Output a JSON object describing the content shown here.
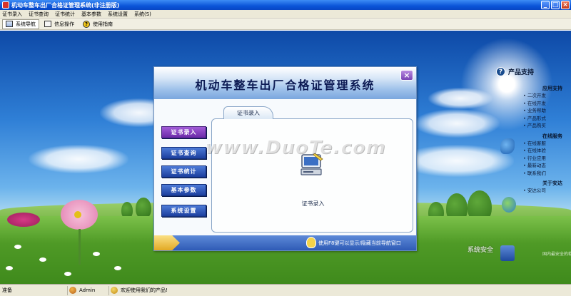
{
  "window": {
    "title": "机动车整车出厂合格证管理系统(非注册版)",
    "controls": {
      "minimize": "_",
      "maximize": "□",
      "close": "×"
    }
  },
  "menu": [
    "证书录入",
    "证书查询",
    "证书统计",
    "基本参数",
    "系统设置",
    "系统(S)"
  ],
  "toolbar": [
    {
      "label": "系统导航",
      "icon": "nav-icon"
    },
    {
      "label": "信息操作",
      "icon": "info-icon"
    },
    {
      "label": "使用指南",
      "icon": "help-icon"
    }
  ],
  "dialog": {
    "title": "机动车整车出厂合格证管理系统",
    "close": "×",
    "side_buttons": [
      "证书录入",
      "证书查询",
      "证书统计",
      "基本参数",
      "系统设置"
    ],
    "active_button": "证书录入",
    "tab": "证书录入",
    "panel_label": "证书录入",
    "footer_hint": "使用F8键可以显示/隐藏当前导航窗口"
  },
  "watermark": "www.DuoTe.com",
  "right_panel": {
    "title": "产品支持",
    "sections": [
      {
        "title": "应用支持",
        "links": [
          "二次开发",
          "在线开发",
          "业务帮助",
          "产品形式",
          "产品购买"
        ]
      },
      {
        "title": "在线服务",
        "links": [
          "在线客服",
          "在线体验",
          "行业应用",
          "最新动态",
          "联系我们"
        ]
      },
      {
        "title": "关于安达",
        "links": [
          "安达公司"
        ]
      }
    ]
  },
  "corner_watermark": {
    "line1": "系统安全",
    "line2": "国内最安全的软件站"
  },
  "status": {
    "ready": "准备",
    "user": "Admin",
    "welcome": "欢迎使用我们的产品!"
  },
  "colors": {
    "titlebar": "#0a54d8",
    "active_button": "#8a44c4",
    "nav_button": "#2a52b8",
    "footer": "#3a66c0"
  }
}
